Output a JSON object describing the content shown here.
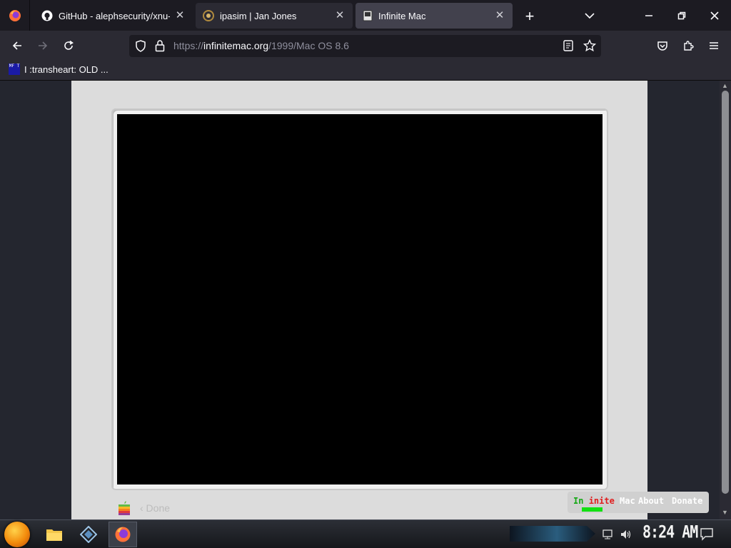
{
  "tabs": [
    {
      "title": "GitHub - alephsecurity/xnu-q",
      "icon": "github-icon"
    },
    {
      "title": "ipasim | Jan Jones",
      "icon": "loading-icon"
    },
    {
      "title": "Infinite Mac",
      "icon": "mac-icon"
    }
  ],
  "url": {
    "scheme": "https://",
    "domain": "infinitemac.org",
    "path": "/1999/Mac OS 8.6"
  },
  "bookmarks": [
    {
      "label": "I :transheart: OLD ...",
      "favicon_text": "MF T"
    }
  ],
  "page": {
    "done_label": "‹ Done",
    "brand_parts": [
      "In",
      "inite",
      "Mac"
    ],
    "brand_colors": [
      "#13a813",
      "#e01e1e",
      "#e01ee0",
      "#1e1ee0",
      "#ffffff"
    ],
    "about_label": "About",
    "donate_label": "Donate"
  },
  "taskbar": {
    "clock": "8:24 AM"
  }
}
